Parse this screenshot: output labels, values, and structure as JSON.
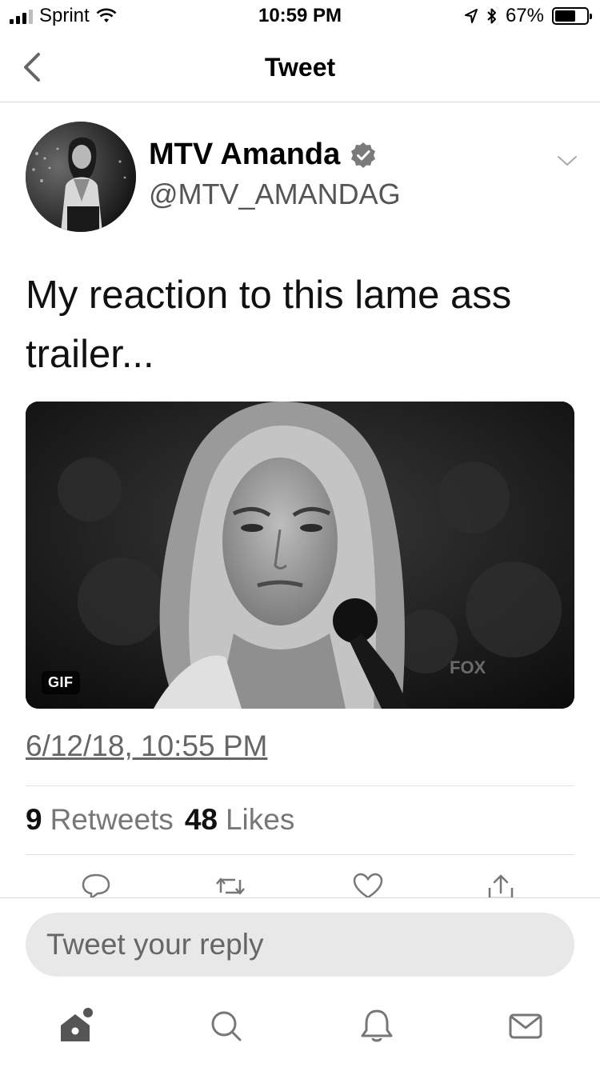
{
  "status_bar": {
    "carrier": "Sprint",
    "time": "10:59 PM",
    "battery_percent": "67%",
    "battery_level": 0.67
  },
  "nav": {
    "title": "Tweet"
  },
  "tweet": {
    "author_name": "MTV Amanda",
    "author_handle": "@MTV_AMANDAG",
    "text": "My reaction to this lame ass trailer...",
    "media_badge": "GIF",
    "media_watermark": "FOX",
    "timestamp": "6/12/18, 10:55 PM",
    "retweet_count": "9",
    "retweet_label": "Retweets",
    "like_count": "48",
    "like_label": "Likes"
  },
  "reply": {
    "placeholder": "Tweet your reply"
  },
  "icons": {
    "back": "chevron-left-icon",
    "verified": "verified-badge-icon",
    "caret": "chevron-down-icon",
    "reply": "reply-icon",
    "retweet": "retweet-icon",
    "like": "heart-icon",
    "share": "share-icon",
    "home": "home-icon",
    "search": "search-icon",
    "notifications": "bell-icon",
    "messages": "mail-icon"
  }
}
